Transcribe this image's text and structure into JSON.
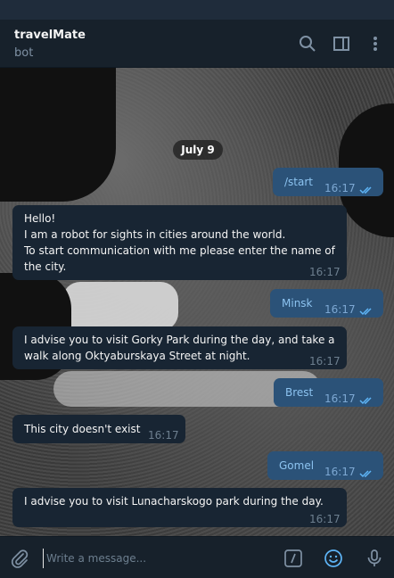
{
  "header": {
    "title": "travelMate",
    "subtitle": "bot",
    "icons": [
      "search-icon",
      "sidebar-toggle-icon",
      "more-vertical-icon"
    ]
  },
  "chat": {
    "date": "July 9",
    "messages": [
      {
        "dir": "out",
        "text": "/start",
        "time": "16:17",
        "status": "read"
      },
      {
        "dir": "in",
        "text": "Hello!\nI am a robot for sights in cities around the world.\nTo start communication with me please enter the name of\nthe city.",
        "time": "16:17"
      },
      {
        "dir": "out",
        "text": "Minsk",
        "time": "16:17",
        "status": "read"
      },
      {
        "dir": "in",
        "text": "I advise you to visit Gorky Park during the day, and take a\nwalk along Oktyaburskaya Street at night.",
        "time": "16:17"
      },
      {
        "dir": "out",
        "text": "Brest",
        "time": "16:17",
        "status": "read"
      },
      {
        "dir": "in",
        "text": "This city doesn't exist",
        "time": "16:17"
      },
      {
        "dir": "out",
        "text": "Gomel",
        "time": "16:17",
        "status": "read"
      },
      {
        "dir": "in",
        "text": "I advise you to visit Lunacharskogo park during the day.",
        "time": "16:17"
      }
    ]
  },
  "composer": {
    "placeholder": "Write a message...",
    "icons": [
      "attach-icon",
      "bot-commands-icon",
      "emoji-icon",
      "microphone-icon"
    ]
  },
  "colors": {
    "header_bg": "#17212b",
    "incoming_bubble": "#182533",
    "outgoing_bubble": "#2b5278",
    "accent": "#5eb5f7"
  }
}
